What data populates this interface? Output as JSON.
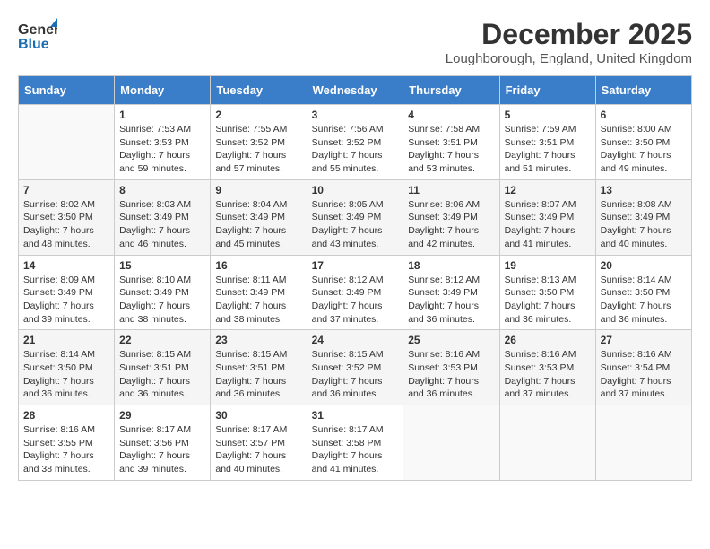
{
  "header": {
    "logo_line1": "General",
    "logo_line2": "Blue",
    "month": "December 2025",
    "location": "Loughborough, England, United Kingdom"
  },
  "days_of_week": [
    "Sunday",
    "Monday",
    "Tuesday",
    "Wednesday",
    "Thursday",
    "Friday",
    "Saturday"
  ],
  "weeks": [
    [
      {
        "day": "",
        "info": ""
      },
      {
        "day": "1",
        "info": "Sunrise: 7:53 AM\nSunset: 3:53 PM\nDaylight: 7 hours\nand 59 minutes."
      },
      {
        "day": "2",
        "info": "Sunrise: 7:55 AM\nSunset: 3:52 PM\nDaylight: 7 hours\nand 57 minutes."
      },
      {
        "day": "3",
        "info": "Sunrise: 7:56 AM\nSunset: 3:52 PM\nDaylight: 7 hours\nand 55 minutes."
      },
      {
        "day": "4",
        "info": "Sunrise: 7:58 AM\nSunset: 3:51 PM\nDaylight: 7 hours\nand 53 minutes."
      },
      {
        "day": "5",
        "info": "Sunrise: 7:59 AM\nSunset: 3:51 PM\nDaylight: 7 hours\nand 51 minutes."
      },
      {
        "day": "6",
        "info": "Sunrise: 8:00 AM\nSunset: 3:50 PM\nDaylight: 7 hours\nand 49 minutes."
      }
    ],
    [
      {
        "day": "7",
        "info": "Sunrise: 8:02 AM\nSunset: 3:50 PM\nDaylight: 7 hours\nand 48 minutes."
      },
      {
        "day": "8",
        "info": "Sunrise: 8:03 AM\nSunset: 3:49 PM\nDaylight: 7 hours\nand 46 minutes."
      },
      {
        "day": "9",
        "info": "Sunrise: 8:04 AM\nSunset: 3:49 PM\nDaylight: 7 hours\nand 45 minutes."
      },
      {
        "day": "10",
        "info": "Sunrise: 8:05 AM\nSunset: 3:49 PM\nDaylight: 7 hours\nand 43 minutes."
      },
      {
        "day": "11",
        "info": "Sunrise: 8:06 AM\nSunset: 3:49 PM\nDaylight: 7 hours\nand 42 minutes."
      },
      {
        "day": "12",
        "info": "Sunrise: 8:07 AM\nSunset: 3:49 PM\nDaylight: 7 hours\nand 41 minutes."
      },
      {
        "day": "13",
        "info": "Sunrise: 8:08 AM\nSunset: 3:49 PM\nDaylight: 7 hours\nand 40 minutes."
      }
    ],
    [
      {
        "day": "14",
        "info": "Sunrise: 8:09 AM\nSunset: 3:49 PM\nDaylight: 7 hours\nand 39 minutes."
      },
      {
        "day": "15",
        "info": "Sunrise: 8:10 AM\nSunset: 3:49 PM\nDaylight: 7 hours\nand 38 minutes."
      },
      {
        "day": "16",
        "info": "Sunrise: 8:11 AM\nSunset: 3:49 PM\nDaylight: 7 hours\nand 38 minutes."
      },
      {
        "day": "17",
        "info": "Sunrise: 8:12 AM\nSunset: 3:49 PM\nDaylight: 7 hours\nand 37 minutes."
      },
      {
        "day": "18",
        "info": "Sunrise: 8:12 AM\nSunset: 3:49 PM\nDaylight: 7 hours\nand 36 minutes."
      },
      {
        "day": "19",
        "info": "Sunrise: 8:13 AM\nSunset: 3:50 PM\nDaylight: 7 hours\nand 36 minutes."
      },
      {
        "day": "20",
        "info": "Sunrise: 8:14 AM\nSunset: 3:50 PM\nDaylight: 7 hours\nand 36 minutes."
      }
    ],
    [
      {
        "day": "21",
        "info": "Sunrise: 8:14 AM\nSunset: 3:50 PM\nDaylight: 7 hours\nand 36 minutes."
      },
      {
        "day": "22",
        "info": "Sunrise: 8:15 AM\nSunset: 3:51 PM\nDaylight: 7 hours\nand 36 minutes."
      },
      {
        "day": "23",
        "info": "Sunrise: 8:15 AM\nSunset: 3:51 PM\nDaylight: 7 hours\nand 36 minutes."
      },
      {
        "day": "24",
        "info": "Sunrise: 8:15 AM\nSunset: 3:52 PM\nDaylight: 7 hours\nand 36 minutes."
      },
      {
        "day": "25",
        "info": "Sunrise: 8:16 AM\nSunset: 3:53 PM\nDaylight: 7 hours\nand 36 minutes."
      },
      {
        "day": "26",
        "info": "Sunrise: 8:16 AM\nSunset: 3:53 PM\nDaylight: 7 hours\nand 37 minutes."
      },
      {
        "day": "27",
        "info": "Sunrise: 8:16 AM\nSunset: 3:54 PM\nDaylight: 7 hours\nand 37 minutes."
      }
    ],
    [
      {
        "day": "28",
        "info": "Sunrise: 8:16 AM\nSunset: 3:55 PM\nDaylight: 7 hours\nand 38 minutes."
      },
      {
        "day": "29",
        "info": "Sunrise: 8:17 AM\nSunset: 3:56 PM\nDaylight: 7 hours\nand 39 minutes."
      },
      {
        "day": "30",
        "info": "Sunrise: 8:17 AM\nSunset: 3:57 PM\nDaylight: 7 hours\nand 40 minutes."
      },
      {
        "day": "31",
        "info": "Sunrise: 8:17 AM\nSunset: 3:58 PM\nDaylight: 7 hours\nand 41 minutes."
      },
      {
        "day": "",
        "info": ""
      },
      {
        "day": "",
        "info": ""
      },
      {
        "day": "",
        "info": ""
      }
    ]
  ]
}
